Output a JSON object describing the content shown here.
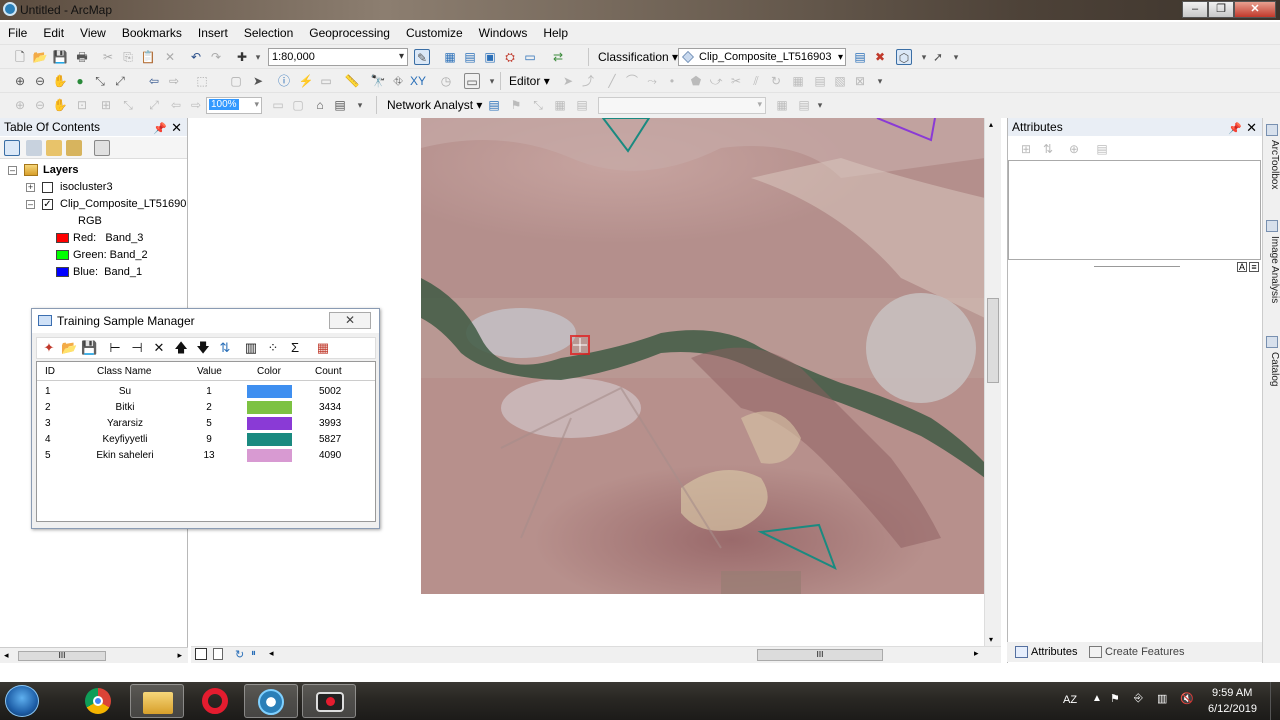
{
  "window": {
    "title": "Untitled - ArcMap"
  },
  "menu": [
    "File",
    "Edit",
    "View",
    "Bookmarks",
    "Insert",
    "Selection",
    "Geoprocessing",
    "Customize",
    "Windows",
    "Help"
  ],
  "toolbar1": {
    "scale": "1:80,000",
    "classification_label": "Classification",
    "layer_combo": "Clip_Composite_LT516903"
  },
  "toolbar2": {
    "editor_label": "Editor"
  },
  "toolbar3": {
    "zoom": "100%",
    "network_analyst_label": "Network Analyst"
  },
  "toc": {
    "title": "Table Of Contents",
    "root": "Layers",
    "layers": [
      {
        "name": "isocluster3",
        "checked": false,
        "expanded": false
      },
      {
        "name": "Clip_Composite_LT51690",
        "checked": true,
        "expanded": true
      }
    ],
    "rgb_label": "RGB",
    "bands": [
      {
        "label": "Red:   Band_3",
        "color": "#ff0000"
      },
      {
        "label": "Green: Band_2",
        "color": "#00ff00"
      },
      {
        "label": "Blue:  Band_1",
        "color": "#0000ff"
      }
    ],
    "hscroll_grip": "III"
  },
  "training_sample_manager": {
    "title": "Training Sample Manager",
    "columns": [
      "ID",
      "Class Name",
      "Value",
      "Color",
      "Count"
    ],
    "rows": [
      {
        "id": "1",
        "name": "Su",
        "value": "1",
        "color": "#3f8ff0",
        "count": "5002"
      },
      {
        "id": "2",
        "name": "Bitki",
        "value": "2",
        "color": "#7dc242",
        "count": "3434"
      },
      {
        "id": "3",
        "name": "Yararsiz",
        "value": "5",
        "color": "#8a3ad6",
        "count": "3993"
      },
      {
        "id": "4",
        "name": "Keyfiyyetli",
        "value": "9",
        "color": "#1a8a80",
        "count": "5827"
      },
      {
        "id": "5",
        "name": "Ekin saheleri",
        "value": "13",
        "color": "#d89ad2",
        "count": "4090"
      }
    ]
  },
  "attributes": {
    "title": "Attributes",
    "tab_attributes": "Attributes",
    "tab_create_features": "Create Features"
  },
  "side_tabs": [
    "ArcToolbox",
    "Image Analysis",
    "Catalog"
  ],
  "map": {
    "hscroll_grip": "III"
  },
  "taskbar": {
    "language": "AZ",
    "time": "9:59 AM",
    "date": "6/12/2019"
  }
}
